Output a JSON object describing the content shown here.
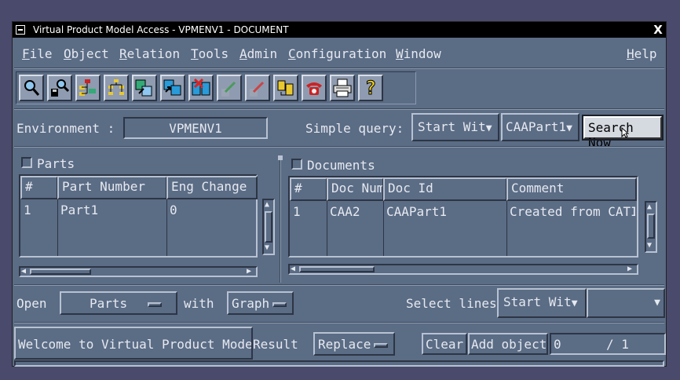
{
  "window": {
    "title": "Virtual Product Model Access - VPMENV1 - DOCUMENT",
    "close_glyph": "X"
  },
  "menu": {
    "file": {
      "key": "F",
      "rest": "ile"
    },
    "object": {
      "key": "O",
      "rest": "bject"
    },
    "relation": {
      "key": "R",
      "rest": "elation"
    },
    "tools": {
      "key": "T",
      "rest": "ools"
    },
    "admin": {
      "key": "A",
      "rest": "dmin"
    },
    "configuration": {
      "key": "C",
      "rest": "onfiguration"
    },
    "window": {
      "key": "W",
      "rest": "indow"
    },
    "help": {
      "key": "H",
      "rest": "elp"
    }
  },
  "toolbar": {
    "icons": [
      "search-icon",
      "save-search-icon",
      "tree-expand-icon",
      "tree-structure-icon",
      "link-icon",
      "copy-icon",
      "delete-link-icon",
      "move-icon",
      "edit-icon",
      "attach-icon",
      "phone-icon",
      "printer-icon",
      "help-icon"
    ],
    "help_glyph": "?"
  },
  "environment": {
    "label": "Environment :",
    "value": "VPMENV1"
  },
  "query": {
    "label": "Simple query:",
    "mode": "Start Wit",
    "value": "CAAPart1",
    "search_label": "Search Now"
  },
  "parts": {
    "title": "Parts",
    "columns": [
      "#",
      "Part Number",
      "Eng Change"
    ],
    "rows": [
      [
        "1",
        "Part1",
        "0"
      ]
    ]
  },
  "documents": {
    "title": "Documents",
    "columns": [
      "#",
      "Doc Num",
      "Doc Id",
      "Comment"
    ],
    "rows": [
      [
        "1",
        "CAA2",
        "CAAPart1",
        "Created from CATIA"
      ]
    ]
  },
  "open_row": {
    "open_label": "Open",
    "open_value": "Parts",
    "with_label": "with",
    "with_value": "Graph",
    "select_label": "Select lines",
    "select_mode": "Start Wit",
    "select_value": ""
  },
  "status_row": {
    "message": "Welcome to Virtual Product Model Access",
    "result_label": "Result",
    "result_value": "Replace",
    "clear_label": "Clear",
    "add_label": "Add object",
    "count_current": "0",
    "count_total": "/ 1"
  },
  "colors": {
    "background": "#5b6c85",
    "desktop": "#4a4a6c",
    "titlebar": "#000000"
  }
}
